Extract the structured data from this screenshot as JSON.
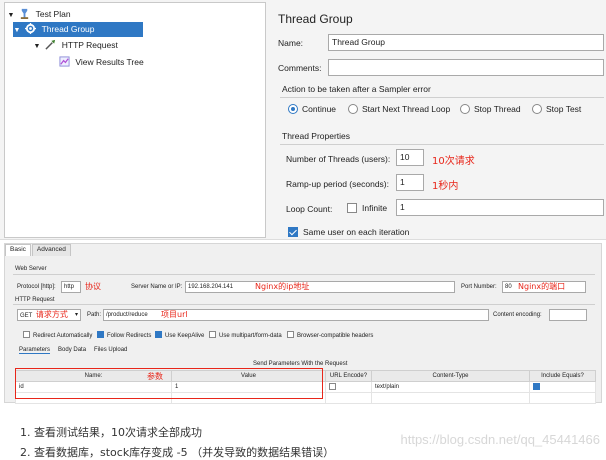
{
  "tree": {
    "items": [
      {
        "label": "Test Plan",
        "icon": "test-plan-icon",
        "expanded": true,
        "selected": false
      },
      {
        "label": "Thread Group",
        "icon": "gear-icon",
        "expanded": true,
        "selected": true
      },
      {
        "label": "HTTP Request",
        "icon": "pipette-icon",
        "expanded": true,
        "selected": false
      },
      {
        "label": "View Results Tree",
        "icon": "chart-icon",
        "expanded": false,
        "selected": false
      }
    ]
  },
  "thread_group": {
    "title": "Thread Group",
    "name_label": "Name:",
    "name_value": "Thread Group",
    "comments_label": "Comments:",
    "comments_value": "",
    "sampler_error_title": "Action to be taken after a Sampler error",
    "sampler_error_options": [
      {
        "label": "Continue",
        "selected": true
      },
      {
        "label": "Start Next Thread Loop",
        "selected": false
      },
      {
        "label": "Stop Thread",
        "selected": false
      },
      {
        "label": "Stop Test",
        "selected": false
      }
    ],
    "thread_props_title": "Thread Properties",
    "threads_label": "Number of Threads (users):",
    "threads_value": "10",
    "threads_note": "10次请求",
    "rampup_label": "Ramp-up period (seconds):",
    "rampup_value": "1",
    "rampup_note": "1秒内",
    "loop_label": "Loop Count:",
    "infinite_label": "Infinite",
    "infinite_checked": false,
    "loop_value": "1",
    "same_user_label": "Same user on each iteration",
    "same_user_checked": true
  },
  "http_request": {
    "tabs": [
      {
        "label": "Basic",
        "active": true
      },
      {
        "label": "Advanced",
        "active": false
      }
    ],
    "web_server_title": "Web Server",
    "protocol_label": "Protocol [http]:",
    "protocol_value": "http",
    "protocol_note": "协议",
    "server_label": "Server Name or IP:",
    "server_value": "192.168.204.141",
    "server_note": "Nginx的ip地址",
    "port_label": "Port Number:",
    "port_value": "80",
    "port_note": "Nginx的端口",
    "http_request_title": "HTTP Request",
    "method_value": "GET",
    "method_note": "请求方式",
    "path_label": "Path:",
    "path_value": "/product/reduce",
    "path_note": "项目url",
    "encoding_label": "Content encoding:",
    "encoding_value": "",
    "checkboxes": [
      {
        "label": "Redirect Automatically",
        "checked": false
      },
      {
        "label": "Follow Redirects",
        "checked": true
      },
      {
        "label": "Use KeepAlive",
        "checked": true
      },
      {
        "label": "Use multipart/form-data",
        "checked": false
      },
      {
        "label": "Browser-compatible headers",
        "checked": false
      }
    ],
    "sub_tabs": [
      {
        "label": "Parameters",
        "active": true
      },
      {
        "label": "Body Data",
        "active": false
      },
      {
        "label": "Files Upload",
        "active": false
      }
    ],
    "send_params_title": "Send Parameters With the Request",
    "params_note": "参数",
    "columns": [
      "Name:",
      "Value",
      "URL Encode?",
      "Content-Type",
      "Include Equals?"
    ],
    "rows": [
      {
        "name": "id",
        "value": "1",
        "url_encode": false,
        "content_type": "text/plain",
        "include_equals": true
      }
    ]
  },
  "notes": [
    "1. 查看测试结果，10次请求全部成功",
    "2. 查看数据库，stock库存变成 -5 （并发导致的数据结果错误）"
  ],
  "watermark": "https://blog.csdn.net/qq_45441466",
  "colors": {
    "accent": "#2f78c4",
    "annotation": "#e8261a"
  }
}
